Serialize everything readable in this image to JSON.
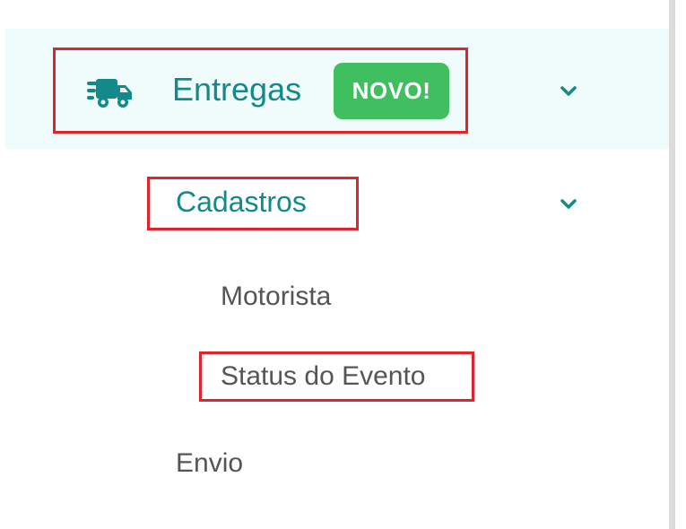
{
  "menu": {
    "entregas": {
      "label": "Entregas",
      "badge": "NOVO!",
      "icon": "truck-icon",
      "expanded_icon": "chevron-down-icon"
    },
    "cadastros": {
      "label": "Cadastros",
      "expanded_icon": "chevron-down-icon",
      "items": [
        {
          "label": "Motorista"
        },
        {
          "label": "Status do Evento"
        }
      ]
    },
    "envio": {
      "label": "Envio"
    }
  },
  "colors": {
    "accent": "#138a8a",
    "active_bg": "#f0fcfc",
    "badge_bg": "#3fbf5f",
    "highlight_border": "#e0242c",
    "text_muted": "#555555"
  }
}
